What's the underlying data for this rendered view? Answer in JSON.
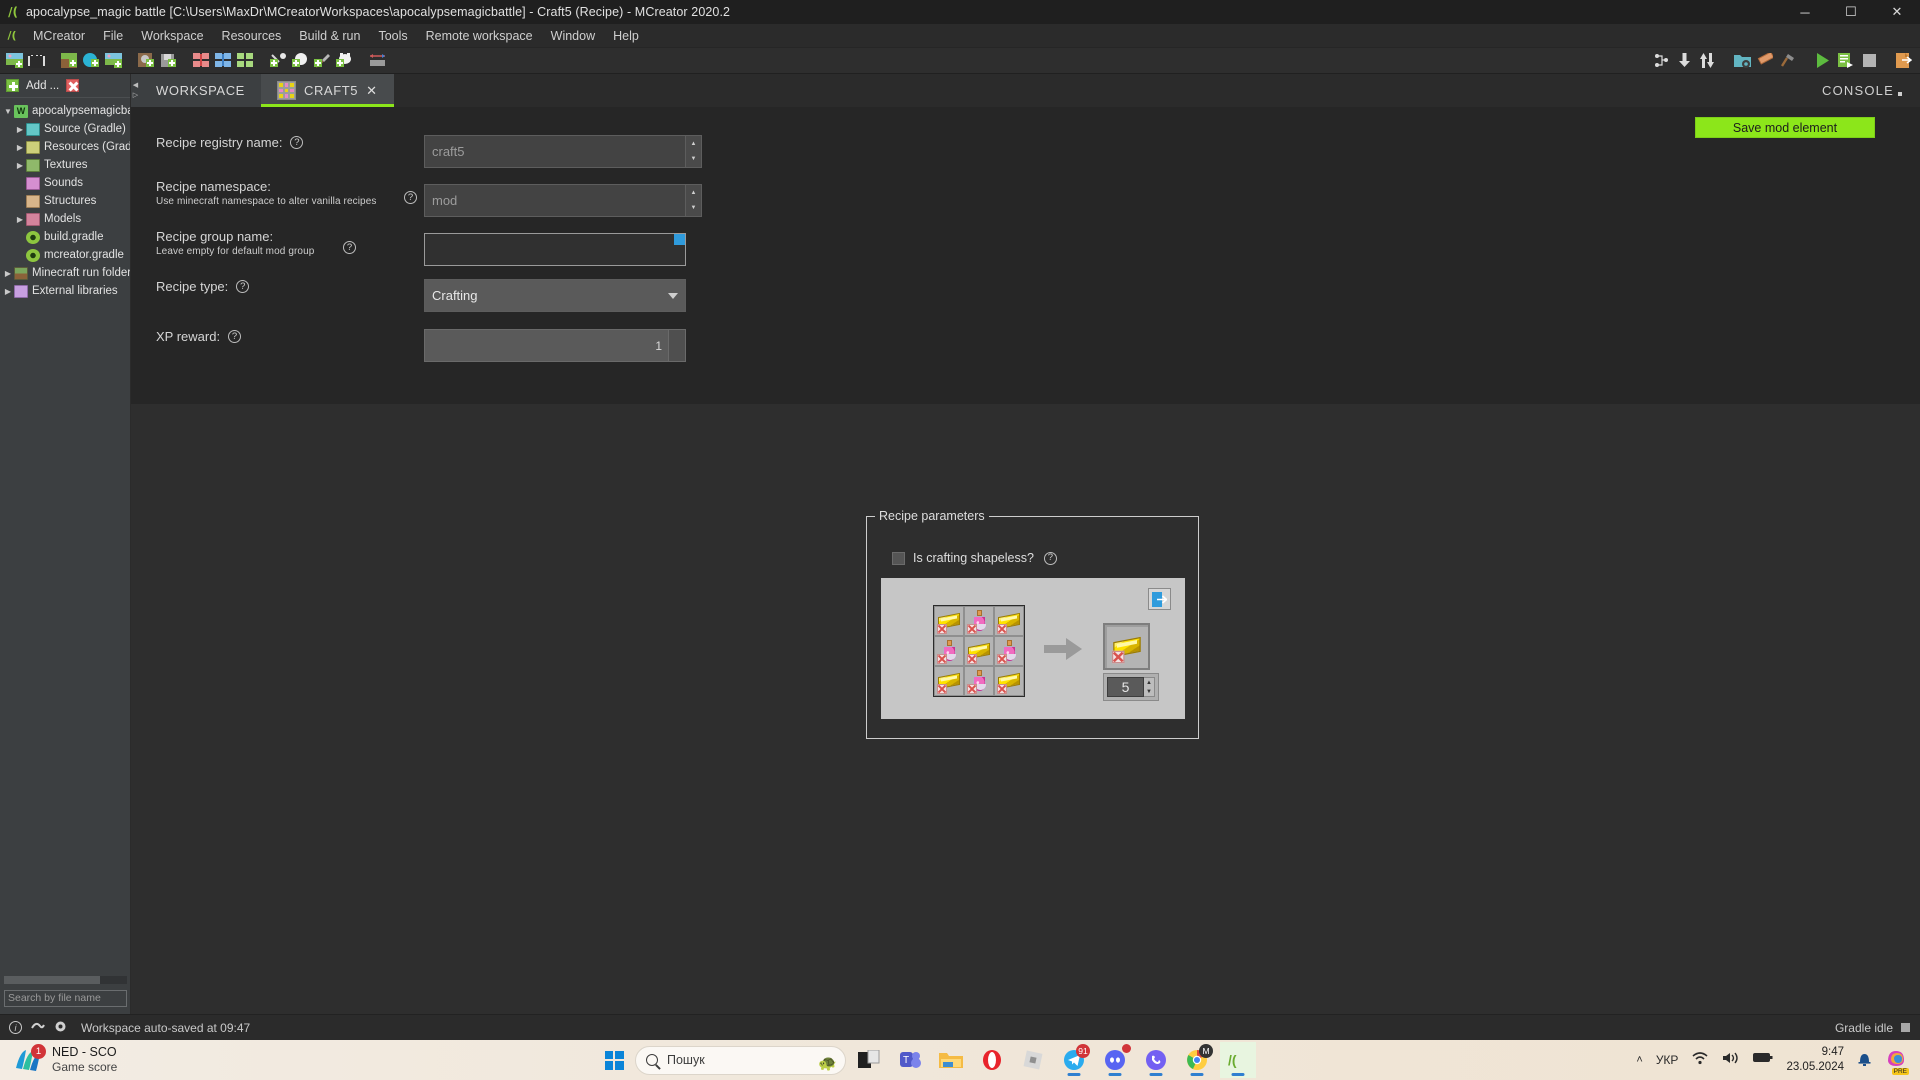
{
  "window": {
    "title": "apocalypse_magic battle [C:\\Users\\MaxDr\\MCreatorWorkspaces\\apocalypsemagicbattle] - Craft5 (Recipe) - MCreator 2020.2",
    "app_icon": "mcreator-icon",
    "minimize": "─",
    "maximize": "☐",
    "close": "✕"
  },
  "menubar": {
    "items": [
      {
        "label": "MCreator",
        "mnemonic": "M"
      },
      {
        "label": "File",
        "mnemonic": "F"
      },
      {
        "label": "Workspace",
        "mnemonic": "W"
      },
      {
        "label": "Resources",
        "mnemonic": "R"
      },
      {
        "label": "Build & run",
        "mnemonic": "B"
      },
      {
        "label": "Tools",
        "mnemonic": "T"
      },
      {
        "label": "Remote workspace",
        "mnemonic": "R"
      },
      {
        "label": "Window",
        "mnemonic": "W"
      },
      {
        "label": "Help",
        "mnemonic": "H"
      }
    ]
  },
  "toolbar": {
    "left": [
      "new-mod-element-icon",
      "film-strip-icon",
      "new-block-icon",
      "new-water-icon",
      "new-plant-icon",
      "new-dimension-icon",
      "new-structure-icon",
      "new-red-texture-icon",
      "new-blue-texture-icon",
      "new-green-texture-icon",
      "new-recipe-icon",
      "new-item-icon",
      "new-tool-icon",
      "new-mob-icon",
      "resize-texture-icon"
    ],
    "right": [
      "workspace-settings-icon",
      "import-icon",
      "export-icon",
      "folder-settings-icon",
      "texture-icon",
      "hammer-icon",
      "run-client-icon",
      "build-icon",
      "stop-icon",
      "export-workspace-icon"
    ]
  },
  "sidebar": {
    "add_label": "Add ...",
    "remove_label": "remove",
    "tree": [
      {
        "label": "apocalypsemagicba",
        "icon": "workspace-icon",
        "indent": 0,
        "arrow": "down"
      },
      {
        "label": "Source (Gradle)",
        "icon": "source-folder-icon",
        "indent": 1,
        "arrow": "right"
      },
      {
        "label": "Resources (Gradl",
        "icon": "resources-folder-icon",
        "indent": 1,
        "arrow": "right"
      },
      {
        "label": "Textures",
        "icon": "textures-folder-icon",
        "indent": 1,
        "arrow": "right"
      },
      {
        "label": "Sounds",
        "icon": "sounds-folder-icon",
        "indent": 1,
        "arrow": "none"
      },
      {
        "label": "Structures",
        "icon": "structures-folder-icon",
        "indent": 1,
        "arrow": "none"
      },
      {
        "label": "Models",
        "icon": "models-folder-icon",
        "indent": 1,
        "arrow": "right"
      },
      {
        "label": "build.gradle",
        "icon": "gradle-file-icon",
        "indent": 1,
        "arrow": "none"
      },
      {
        "label": "mcreator.gradle",
        "icon": "gradle-file-icon",
        "indent": 1,
        "arrow": "none"
      },
      {
        "label": "Minecraft run folder",
        "icon": "run-folder-icon",
        "indent": 0,
        "arrow": "right"
      },
      {
        "label": "External libraries",
        "icon": "external-libraries-icon",
        "indent": 0,
        "arrow": "right"
      }
    ],
    "search_placeholder": "Search by file name"
  },
  "tabs": {
    "items": [
      {
        "label": "WORKSPACE",
        "active": false,
        "closable": false
      },
      {
        "label": "CRAFT5",
        "active": true,
        "closable": true,
        "icon": "recipe-grid-icon",
        "close_glyph": "✕"
      }
    ],
    "console_label": "CONSOLE"
  },
  "form": {
    "save_button": "Save mod element",
    "fields": [
      {
        "label": "Recipe registry name:",
        "sub": "",
        "value": "craft5",
        "type": "text-with-dropdown",
        "help": "?"
      },
      {
        "label": "Recipe namespace:",
        "sub": "Use minecraft namespace to alter vanilla recipes",
        "value": "mod",
        "type": "text-with-dropdown",
        "help": "?"
      },
      {
        "label": "Recipe group name:",
        "sub": "Leave empty for default mod group",
        "value": "",
        "type": "text",
        "help": "?"
      },
      {
        "label": "Recipe type:",
        "sub": "",
        "value": "Crafting",
        "type": "combo",
        "help": "?"
      },
      {
        "label": "XP reward:",
        "sub": "",
        "value": "1",
        "type": "number",
        "help": "?"
      }
    ]
  },
  "recipe_panel": {
    "legend": "Recipe parameters",
    "shapeless_label": "Is crafting shapeless?",
    "shapeless_checked": false,
    "shapeless_help": "?",
    "export_icon": "export-recipe-icon",
    "arrow_icon": "craft-arrow-icon",
    "grid": [
      "gold-ingot",
      "potion",
      "gold-ingot",
      "potion",
      "gold-ingot",
      "potion",
      "gold-ingot",
      "potion",
      "gold-ingot"
    ],
    "output_item": "gold-ingot",
    "output_amount": "5",
    "spinner_up": "▲",
    "spinner_down": "▼"
  },
  "statusbar": {
    "icons": [
      "info-icon",
      "plug-icon",
      "gear-icon"
    ],
    "message": "Workspace auto-saved at 09:47",
    "gradle_status": "Gradle idle",
    "stop_icon": "stop-icon"
  },
  "taskbar": {
    "news": {
      "badge": "1",
      "title": "NED - SCO",
      "subtitle": "Game score",
      "icon": "msn-news-icon"
    },
    "start_icon": "windows-start-icon",
    "search_placeholder": "Пошук",
    "search_decoration": "turtle-icon",
    "apps": [
      {
        "name": "task-view-icon",
        "badge": "",
        "active": false
      },
      {
        "name": "microsoft-teams-icon",
        "badge": "",
        "active": false
      },
      {
        "name": "file-explorer-icon",
        "badge": "",
        "active": false
      },
      {
        "name": "opera-icon",
        "badge": "",
        "active": false
      },
      {
        "name": "roblox-icon",
        "badge": "",
        "active": false
      },
      {
        "name": "telegram-icon",
        "badge": "91",
        "active": true
      },
      {
        "name": "discord-icon",
        "badge": "",
        "active": true
      },
      {
        "name": "viber-icon",
        "badge": "",
        "active": true
      },
      {
        "name": "chrome-icon",
        "badge": "M",
        "active": true
      },
      {
        "name": "mcreator-icon",
        "badge": "",
        "active": true
      }
    ],
    "tray": {
      "chevron": "˄",
      "language": "УКР",
      "wifi_icon": "wifi-icon",
      "volume_icon": "volume-icon",
      "battery_icon": "battery-icon",
      "time": "9:47",
      "date": "23.05.2024",
      "notification_icon": "bell-icon",
      "copilot_icon": "copilot-icon",
      "copilot_badge": "PRE"
    }
  },
  "colors": {
    "accent_green": "#8ce61a",
    "window_bg": "#2e2e2e",
    "panel_bg": "#262626",
    "sidebar_bg": "#3c3f41",
    "craft_panel": "#c6c6c6"
  }
}
